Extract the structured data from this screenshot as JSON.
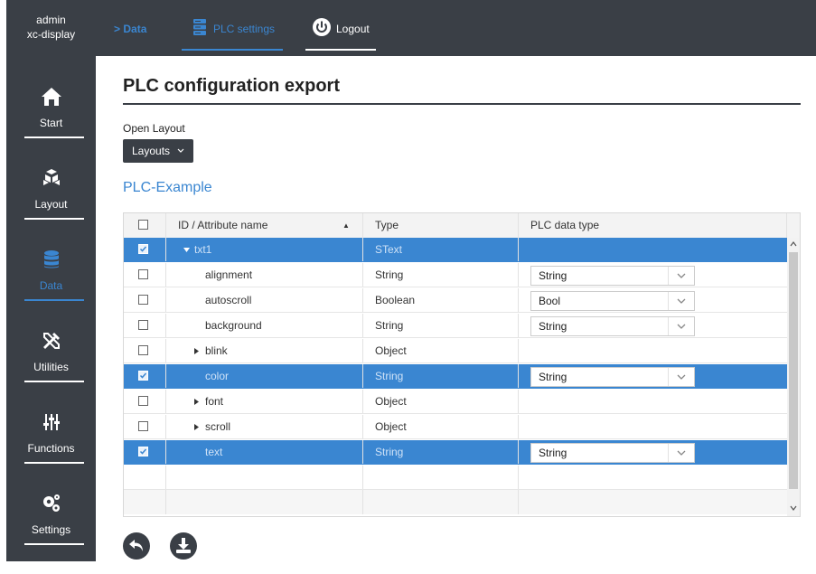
{
  "user": {
    "name": "admin",
    "device": "xc-display"
  },
  "nav": [
    {
      "label": "Start",
      "icon": "home-icon"
    },
    {
      "label": "Layout",
      "icon": "cubes-icon"
    },
    {
      "label": "Data",
      "icon": "database-icon"
    },
    {
      "label": "Utilities",
      "icon": "tools-icon"
    },
    {
      "label": "Functions",
      "icon": "sliders-icon"
    },
    {
      "label": "Settings",
      "icon": "gears-icon"
    }
  ],
  "topbar": {
    "data": "Data",
    "plc_settings": "PLC settings",
    "logout": "Logout"
  },
  "page": {
    "title": "PLC configuration export",
    "open_layout": "Open Layout",
    "layouts_button": "Layouts",
    "section": "PLC-Example"
  },
  "table": {
    "headers": {
      "id": "ID / Attribute name",
      "type": "Type",
      "plc_type": "PLC data type"
    },
    "rows": [
      {
        "name": "txt1",
        "type": "SText",
        "plc": "",
        "checked": true,
        "selected": true
      },
      {
        "name": "alignment",
        "type": "String",
        "plc": "String",
        "checked": false,
        "selected": false
      },
      {
        "name": "autoscroll",
        "type": "Boolean",
        "plc": "Bool",
        "checked": false,
        "selected": false
      },
      {
        "name": "background",
        "type": "String",
        "plc": "String",
        "checked": false,
        "selected": false
      },
      {
        "name": "blink",
        "type": "Object",
        "plc": "",
        "checked": false,
        "selected": false
      },
      {
        "name": "color",
        "type": "String",
        "plc": "String",
        "checked": true,
        "selected": true
      },
      {
        "name": "font",
        "type": "Object",
        "plc": "",
        "checked": false,
        "selected": false
      },
      {
        "name": "scroll",
        "type": "Object",
        "plc": "",
        "checked": false,
        "selected": false
      },
      {
        "name": "text",
        "type": "String",
        "plc": "String",
        "checked": true,
        "selected": true
      }
    ]
  },
  "colors": {
    "dark": "#3a3f46",
    "accent": "#3a86d1"
  }
}
